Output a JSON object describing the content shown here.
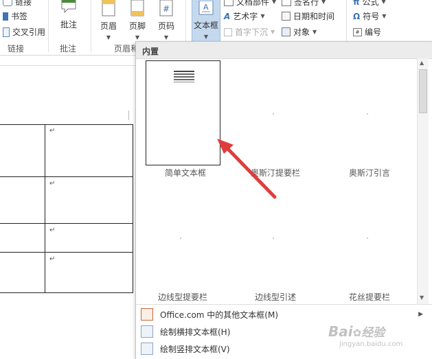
{
  "ribbon": {
    "link_group": {
      "items": [
        {
          "label": "链接",
          "icon": "link-icon"
        },
        {
          "label": "书签",
          "icon": "bookmark-icon"
        },
        {
          "label": "交叉引用",
          "icon": "cross-reference-icon"
        }
      ],
      "group_label": "链接"
    },
    "comment_group": {
      "button_label": "批注",
      "group_label": "批注"
    },
    "header_footer_group": {
      "buttons": [
        {
          "label": "页眉",
          "icon": "header-icon"
        },
        {
          "label": "页脚",
          "icon": "footer-icon"
        },
        {
          "label": "页码",
          "icon": "page-number-icon"
        }
      ],
      "group_label": "页眉和页脚"
    },
    "text_group": {
      "textbox_label": "文本框",
      "items": [
        {
          "label": "文档部件",
          "icon": "quick-parts-icon"
        },
        {
          "label": "艺术字",
          "icon": "wordart-icon"
        },
        {
          "label": "首字下沉",
          "icon": "drop-cap-icon"
        },
        {
          "label": "签名行",
          "icon": "signature-line-icon"
        },
        {
          "label": "日期和时间",
          "icon": "date-time-icon"
        },
        {
          "label": "对象",
          "icon": "object-icon"
        }
      ]
    },
    "symbols_group": {
      "items": [
        {
          "label": "公式",
          "icon": "equation-icon"
        },
        {
          "label": "符号",
          "icon": "symbol-icon"
        },
        {
          "label": "编号",
          "icon": "number-icon"
        }
      ]
    }
  },
  "gallery": {
    "section_label": "内置",
    "items": [
      {
        "label": "简单文本框"
      },
      {
        "label": "奥斯汀提要栏"
      },
      {
        "label": "奥斯汀引言"
      },
      {
        "label": "边线型提要栏"
      },
      {
        "label": "边线型引述"
      },
      {
        "label": "花丝提要栏"
      }
    ],
    "menu": [
      {
        "label": "Office.com 中的其他文本框(M)",
        "icon": "office-com-icon",
        "has_submenu": true
      },
      {
        "label": "绘制横排文本框(H)",
        "icon": "horizontal-textbox-icon",
        "has_submenu": false
      },
      {
        "label": "绘制竖排文本框(V)",
        "icon": "vertical-textbox-icon",
        "has_submenu": false
      }
    ]
  },
  "document": {
    "paragraph_mark": "↵"
  },
  "annotation": {
    "arrow_color": "#e03c3c"
  },
  "watermark": {
    "brand": "Bai",
    "brand_cn": "经验",
    "url": "jingyan.baidu.com"
  },
  "colors": {
    "accent": "#c5d9ee",
    "arrow": "#e03c3c"
  }
}
